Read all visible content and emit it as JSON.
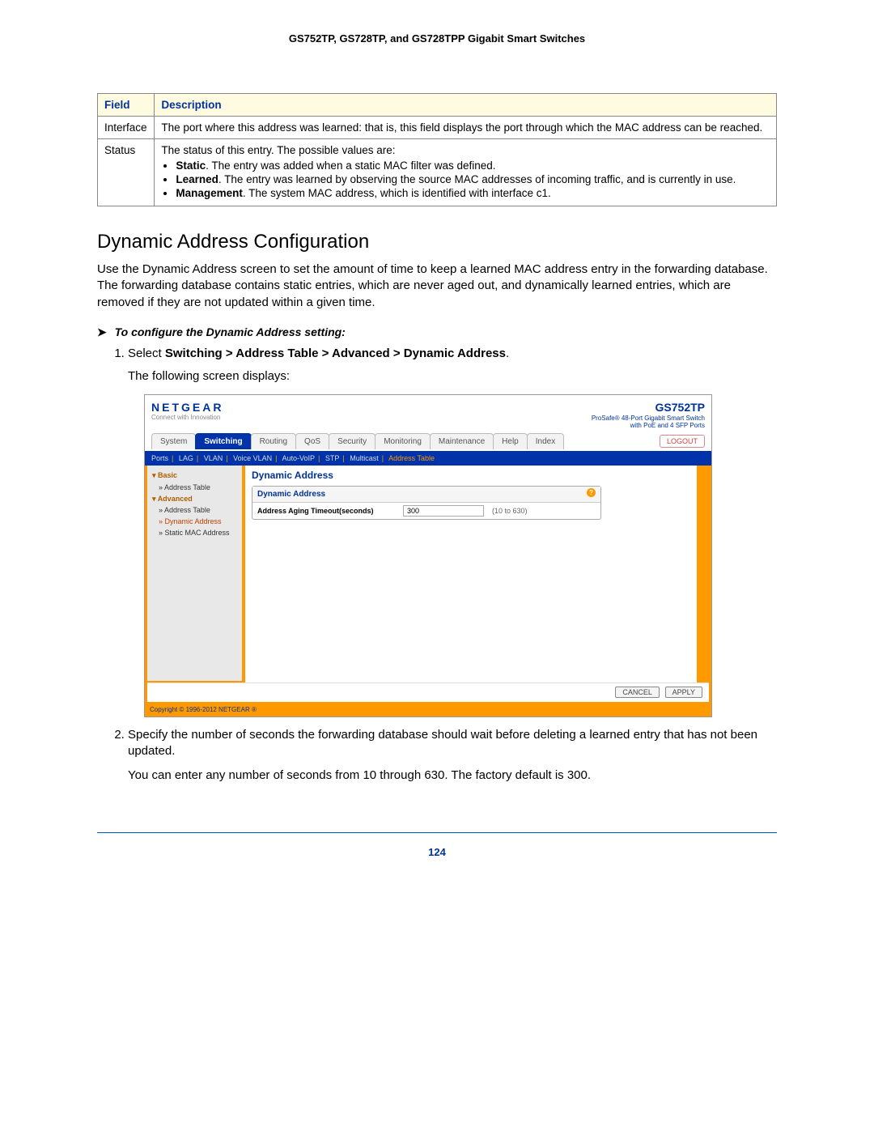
{
  "doc_header": "GS752TP, GS728TP, and GS728TPP Gigabit Smart Switches",
  "table": {
    "headers": [
      "Field",
      "Description"
    ],
    "rows": [
      {
        "field": "Interface",
        "desc": "The port where this address was learned: that is, this field displays the port through which the MAC address can be reached."
      },
      {
        "field": "Status",
        "desc_intro": "The status of this entry. The possible values are:",
        "bullets": [
          {
            "b": "Static",
            "t": ". The entry was added when a static MAC filter was defined."
          },
          {
            "b": "Learned",
            "t": ". The entry was learned by observing the source MAC addresses of incoming traffic, and is currently in use."
          },
          {
            "b": "Management",
            "t": ". The system MAC address, which is identified with interface c1."
          }
        ]
      }
    ]
  },
  "section_title": "Dynamic Address Configuration",
  "intro": "Use the Dynamic Address screen to set the amount of time to keep a learned MAC address entry in the forwarding database. The forwarding database contains static entries, which are never aged out, and dynamically learned entries, which are removed if they are not updated within a given time.",
  "procedure_title": "To configure the Dynamic Address setting:",
  "step1_pre": "Select ",
  "step1_path": "Switching > Address Table > Advanced > Dynamic Address",
  "step1_post": ".",
  "step1_after": "The following screen displays:",
  "step2": "Specify the number of seconds the forwarding database should wait before deleting a learned entry that has not been updated.",
  "step2_after": "You can enter any number of seconds from 10 through 630. The factory default is 300.",
  "page_number": "124",
  "screenshot": {
    "logo": "NETGEAR",
    "logo_sub": "Connect with Innovation",
    "product": "GS752TP",
    "product_sub1": "ProSafe® 48-Port Gigabit Smart Switch",
    "product_sub2": "with PoE and 4 SFP Ports",
    "tabs": [
      "System",
      "Switching",
      "Routing",
      "QoS",
      "Security",
      "Monitoring",
      "Maintenance",
      "Help",
      "Index"
    ],
    "active_tab": "Switching",
    "logout": "LOGOUT",
    "subnav": [
      "Ports",
      "LAG",
      "VLAN",
      "Voice VLAN",
      "Auto-VoIP",
      "STP",
      "Multicast",
      "Address Table"
    ],
    "subnav_active": "Address Table",
    "sidemenu": {
      "basic": "Basic",
      "basic_items": [
        "Address Table"
      ],
      "advanced": "Advanced",
      "advanced_items": [
        "Address Table",
        "Dynamic Address",
        "Static MAC Address"
      ],
      "active": "Dynamic Address"
    },
    "content_title": "Dynamic Address",
    "panel_title": "Dynamic Address",
    "field_label": "Address Aging Timeout(seconds)",
    "field_value": "300",
    "field_range": "(10 to 630)",
    "btn_cancel": "CANCEL",
    "btn_apply": "APPLY",
    "copyright": "Copyright © 1996-2012 NETGEAR ®"
  }
}
